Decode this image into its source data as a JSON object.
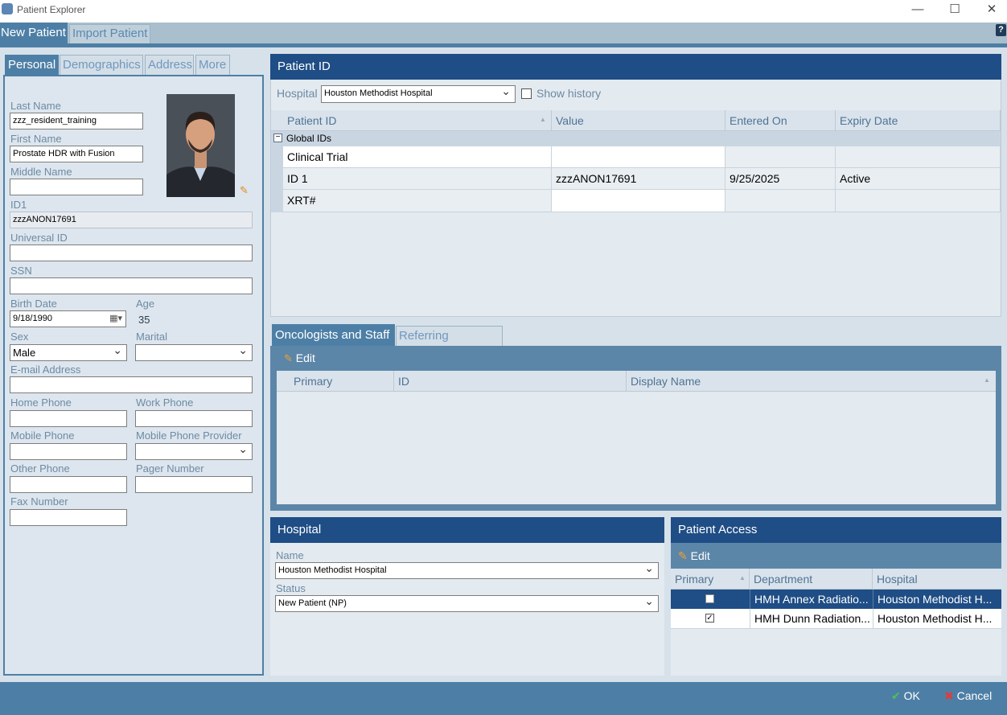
{
  "window": {
    "title": "Patient Explorer",
    "minimize": "—",
    "maximize": "☐",
    "close": "✕"
  },
  "toolbar": {
    "tabs": [
      "New Patient",
      "Import Patient"
    ],
    "help": "?"
  },
  "left_tabs": [
    "Personal",
    "Demographics",
    "Address",
    "More"
  ],
  "personal": {
    "last_name_label": "Last Name",
    "last_name": "zzz_resident_training",
    "first_name_label": "First Name",
    "first_name": "Prostate HDR with Fusion",
    "middle_name_label": "Middle Name",
    "middle_name": "",
    "id1_label": "ID1",
    "id1": "zzzANON17691",
    "universal_id_label": "Universal ID",
    "universal_id": "",
    "ssn_label": "SSN",
    "ssn": "",
    "birth_date_label": "Birth Date",
    "birth_date": "9/18/1990",
    "age_label": "Age",
    "age": "35",
    "sex_label": "Sex",
    "sex": "Male",
    "marital_label": "Marital",
    "marital": "",
    "email_label": "E-mail Address",
    "email": "",
    "home_phone_label": "Home Phone",
    "work_phone_label": "Work Phone",
    "mobile_phone_label": "Mobile Phone",
    "mobile_provider_label": "Mobile Phone Provider",
    "other_phone_label": "Other Phone",
    "pager_label": "Pager Number",
    "fax_label": "Fax Number"
  },
  "patient_id": {
    "title": "Patient ID",
    "hospital_label": "Hospital",
    "hospital": "Houston Methodist Hospital",
    "show_history": "Show history",
    "columns": [
      "Patient ID",
      "Value",
      "Entered On",
      "Expiry Date"
    ],
    "group": "Global IDs",
    "group_toggle": "−",
    "rows": [
      [
        "Clinical Trial",
        "",
        "",
        ""
      ],
      [
        "ID 1",
        "zzzANON17691",
        "9/25/2025",
        "Active"
      ],
      [
        "XRT#",
        "",
        "",
        ""
      ]
    ]
  },
  "staff": {
    "tabs": [
      "Oncologists and Staff",
      "Referring Physician"
    ],
    "edit": "Edit",
    "columns": [
      "Primary",
      "ID",
      "Display Name"
    ]
  },
  "hospital_panel": {
    "title": "Hospital",
    "name_label": "Name",
    "name": "Houston Methodist Hospital",
    "status_label": "Status",
    "status": "New Patient (NP)"
  },
  "access": {
    "title": "Patient Access",
    "edit": "Edit",
    "columns": [
      "Primary",
      "Department",
      "Hospital"
    ],
    "rows": [
      {
        "department": "HMH Annex Radiatio...",
        "hospital": "Houston Methodist H...",
        "primary": false
      },
      {
        "department": "HMH Dunn Radiation...",
        "hospital": "Houston Methodist H...",
        "primary": true
      }
    ]
  },
  "footer": {
    "ok": "OK",
    "cancel": "Cancel"
  },
  "colors": {
    "accent": "#1f4d85",
    "tab_blue": "#4d7fa6",
    "footer": "#4d7fa6"
  }
}
